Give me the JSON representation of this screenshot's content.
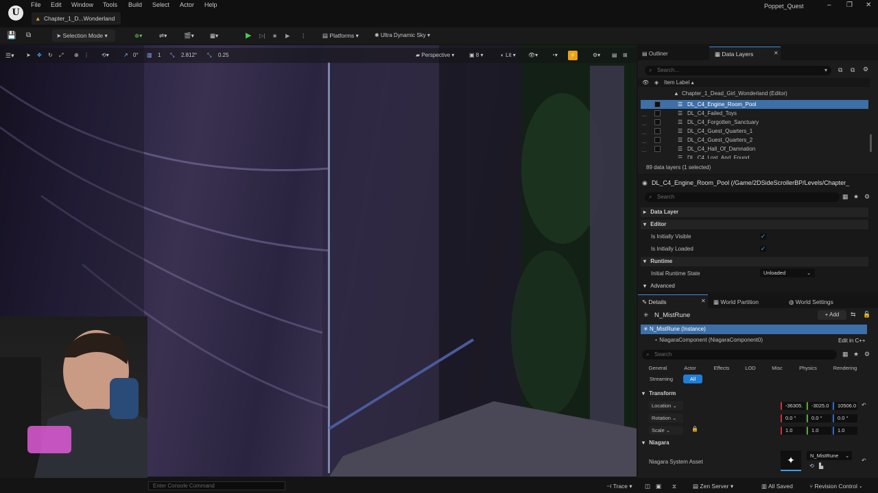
{
  "app": {
    "project_name": "Poppet_Quest",
    "doc_tab": "Chapter_1_D...Wonderland",
    "window_controls": [
      "–",
      "❐",
      "✕"
    ]
  },
  "menu": [
    "File",
    "Edit",
    "Window",
    "Tools",
    "Build",
    "Select",
    "Actor",
    "Help"
  ],
  "toolbar": {
    "selection_mode": "Selection Mode",
    "platforms": "Platforms",
    "ultra_dynamic_sky": "Ultra Dynamic Sky"
  },
  "viewport": {
    "rot_snap": "0°",
    "grid_snap": "1",
    "scale_val": "2.812°",
    "cam_speed": "0.25",
    "perspective": "Perspective",
    "fov_val": "8",
    "lit": "Lit"
  },
  "outliner": {
    "tab_outliner": "Outliner",
    "tab_data_layers": "Data Layers",
    "search_placeholder": "Search...",
    "col_header": "Item Label",
    "root_item": "Chapter_1_Dead_Girl_Wonderland (Editor)",
    "items": [
      "DL_C4_Engine_Room_Pool",
      "DL_C4_Failed_Toys",
      "DL_C4_Forgotten_Sanctuary",
      "DL_C4_Guest_Quarters_1",
      "DL_C4_Guest_Quarters_2",
      "DL_C4_Hall_Of_Damnation",
      "DL_C4_Lost_And_Found"
    ],
    "count_text": "89 data layers (1 selected)"
  },
  "layer_details": {
    "title": "DL_C4_Engine_Room_Pool (/Game/2DSideScrollerBP/Levels/Chapter_",
    "search_placeholder": "Search",
    "section_data_layer": "Data Layer",
    "section_editor": "Editor",
    "is_initially_visible": "Is Initially Visible",
    "is_initially_loaded": "Is Initially Loaded",
    "section_runtime": "Runtime",
    "initial_runtime_state": "Initial Runtime State",
    "runtime_state_value": "Unloaded",
    "section_advanced": "Advanced"
  },
  "details": {
    "tab_details": "Details",
    "tab_world_partition": "World Partition",
    "tab_world_settings": "World Settings",
    "actor_name": "N_MistRune",
    "add_label": "+ Add",
    "instance_label": "N_MistRune (Instance)",
    "component_label": "NiagaraComponent (NiagaraComponent0)",
    "edit_cpp": "Edit in C++",
    "search_placeholder": "Search",
    "filters": [
      "General",
      "Actor",
      "Effects",
      "LOD",
      "Misc",
      "Physics",
      "Rendering",
      "Streaming",
      "All"
    ],
    "section_transform": "Transform",
    "location_label": "Location",
    "location": [
      "-36305.",
      "-3025.0",
      "10506.0"
    ],
    "rotation_label": "Rotation",
    "rotation": [
      "0.0 °",
      "0.0 °",
      "0.0 °"
    ],
    "scale_label": "Scale",
    "scale": [
      "1.0",
      "1.0",
      "1.0"
    ],
    "section_niagara": "Niagara",
    "niagara_asset_label": "Niagara System Asset",
    "niagara_asset_value": "N_MistRune"
  },
  "statusbar": {
    "console_placeholder": "Enter Console Command",
    "trace": "Trace",
    "zen_server": "Zen Server",
    "all_saved": "All Saved",
    "revision_control": "Revision Control"
  }
}
